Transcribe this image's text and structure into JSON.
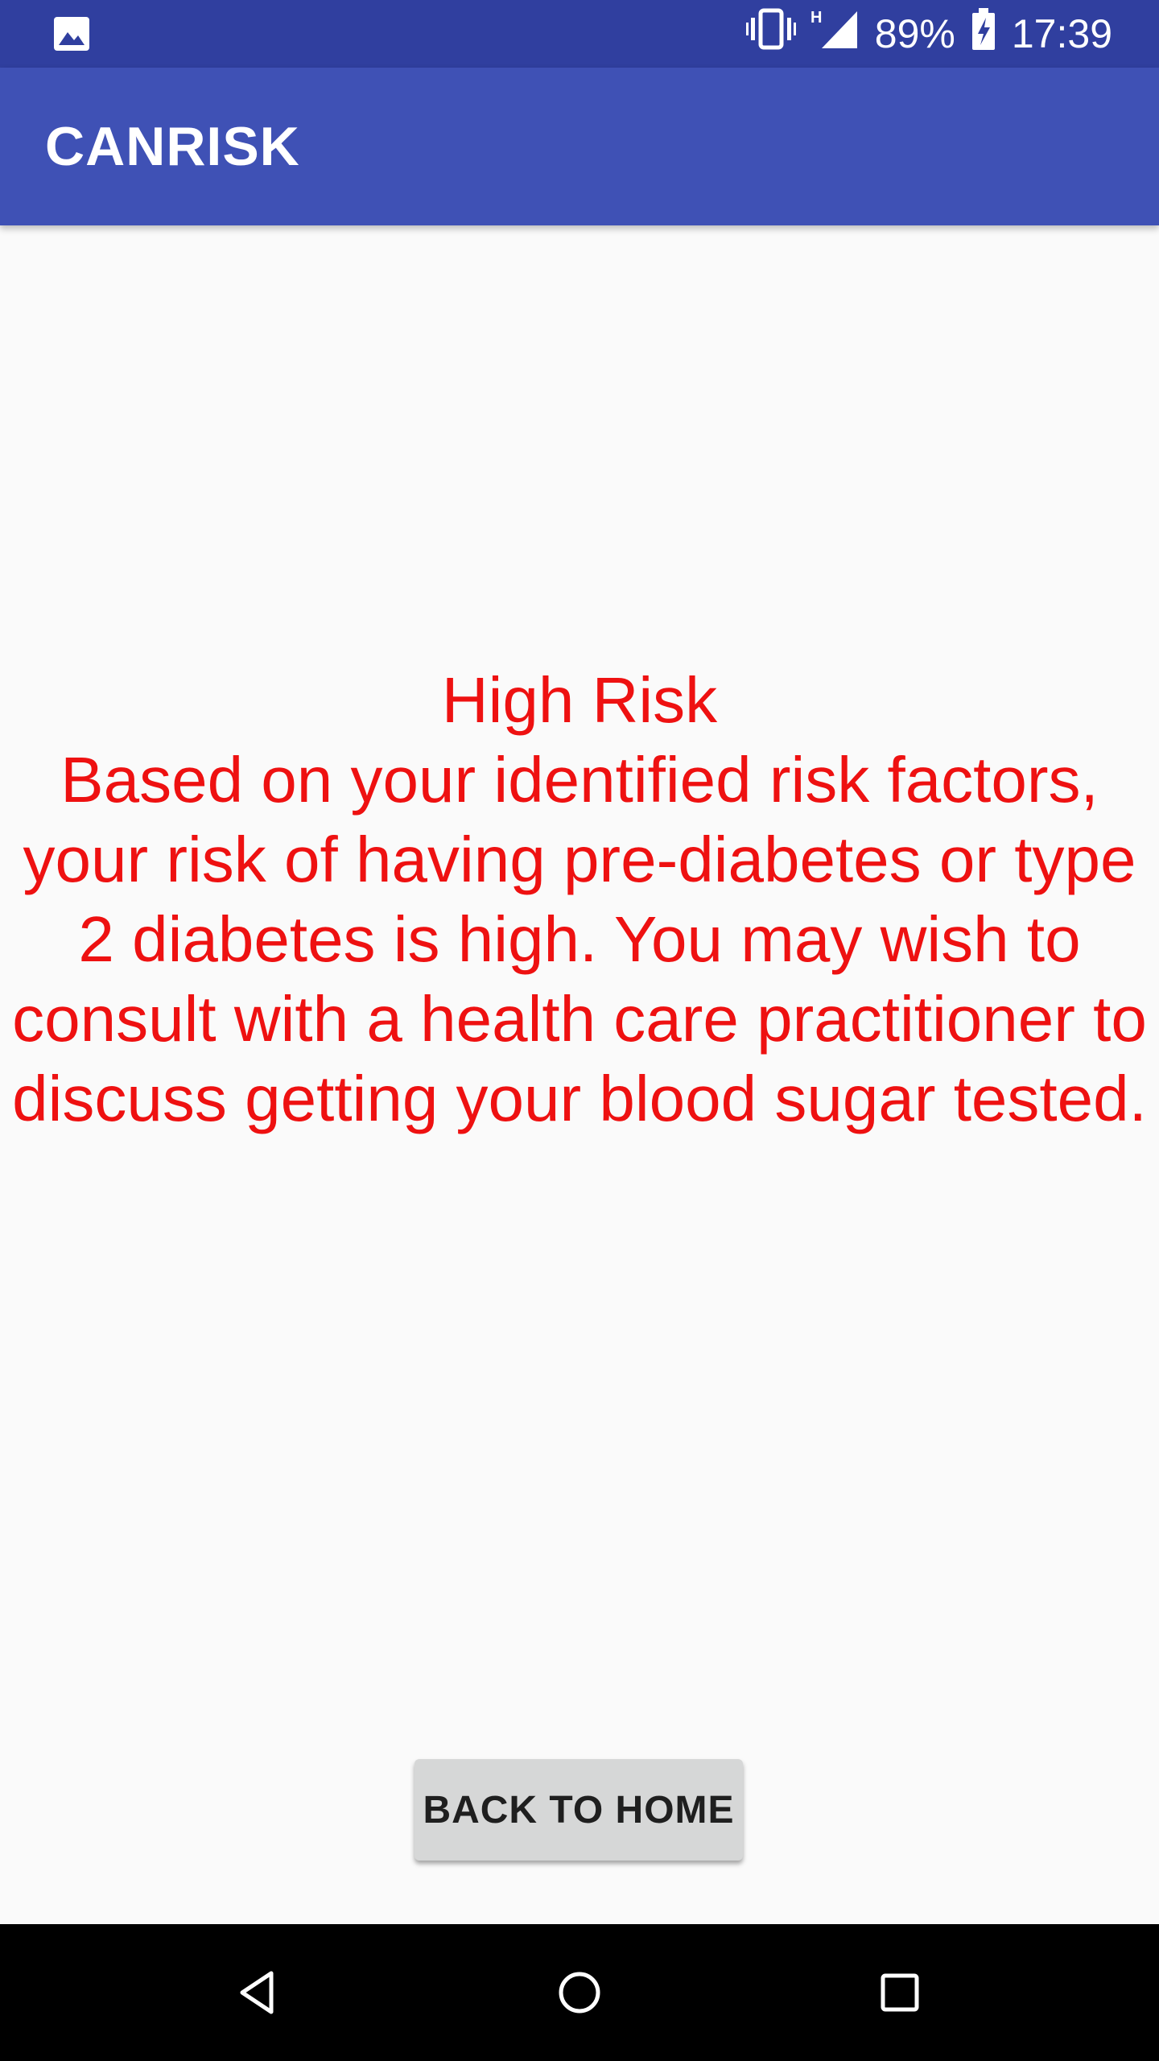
{
  "status_bar": {
    "battery": "89%",
    "time": "17:39",
    "network_type": "H",
    "icons": [
      "image-icon",
      "vibrate-icon",
      "signal-icon",
      "battery-charging-icon"
    ],
    "background_color": "#303f9f"
  },
  "app_bar": {
    "title": "CANRISK",
    "background_color": "#3f51b5"
  },
  "result": {
    "title": "High Risk",
    "message": "Based on your identified risk factors, your risk of having pre-diabetes or type 2 diabetes is high. You may wish to consult with a health care practitioner to discuss getting your blood sugar tested.",
    "text_color": "#ee1111"
  },
  "actions": {
    "back_home_label": "BACK TO HOME"
  },
  "nav_bar": {
    "icons": [
      "back-icon",
      "home-icon",
      "recents-icon"
    ]
  }
}
